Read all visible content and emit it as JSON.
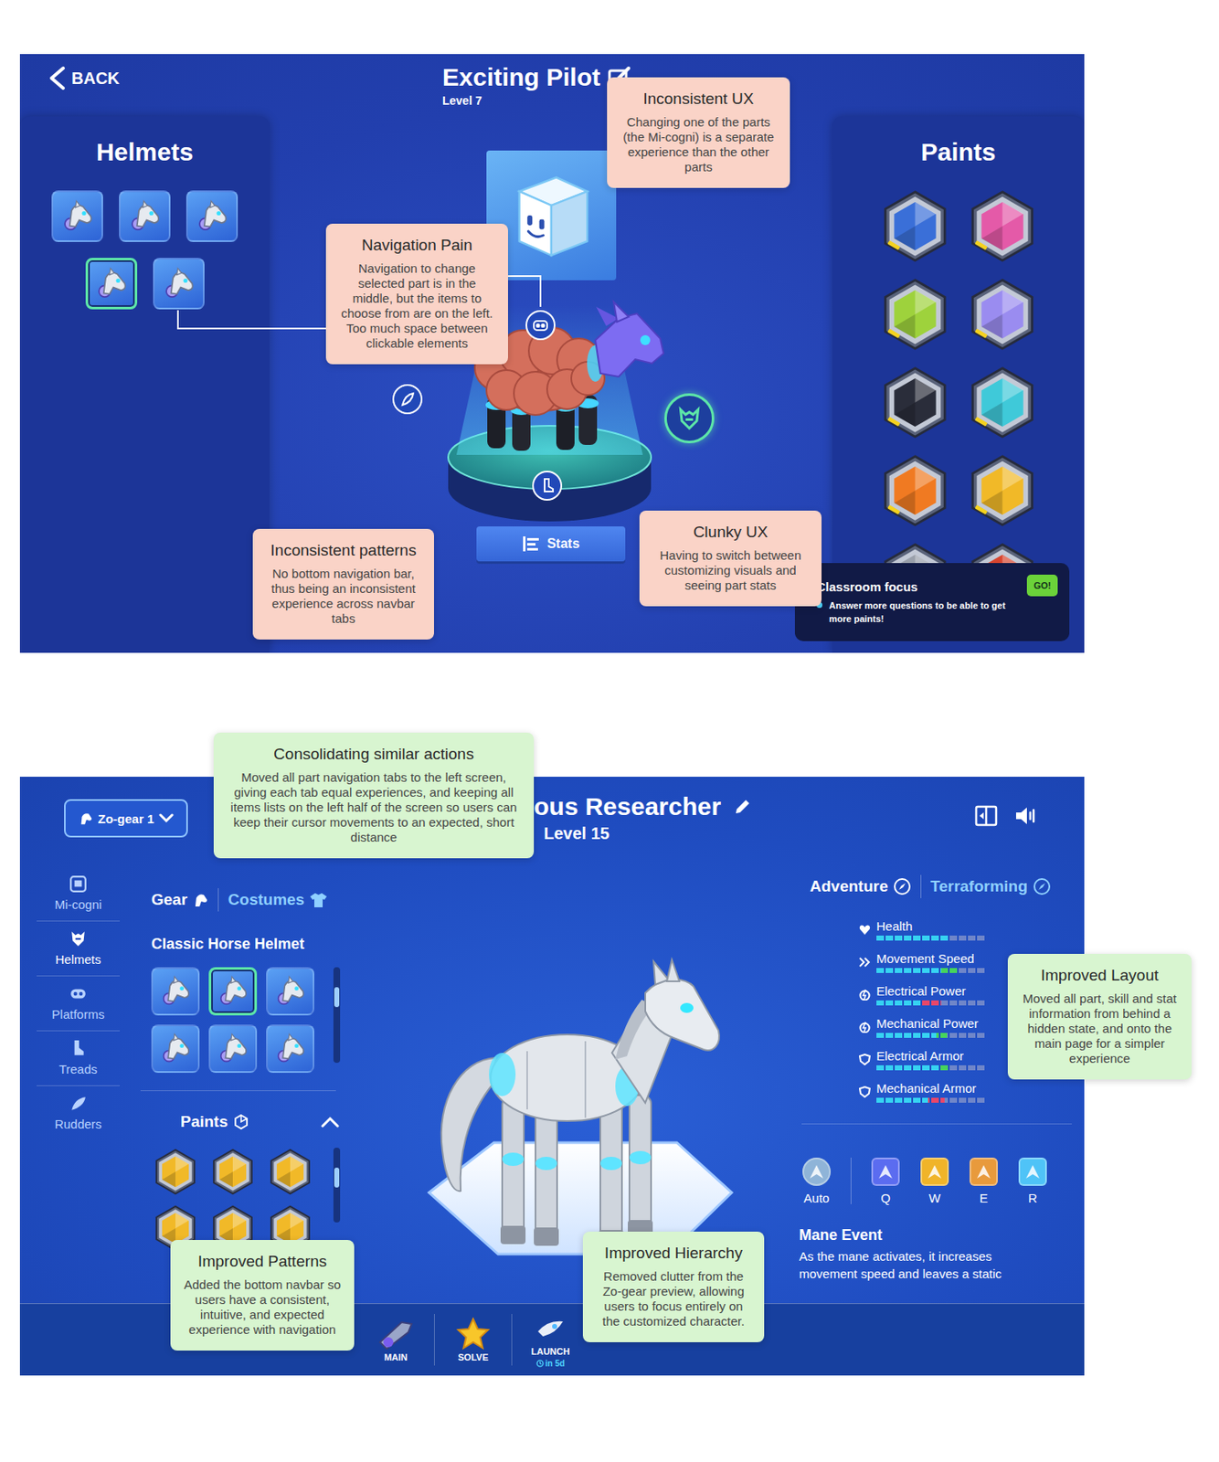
{
  "before": {
    "back": "BACK",
    "title": "Exciting Pilot",
    "level": "Level 7",
    "helmets": {
      "title": "Helmets",
      "items": [
        {
          "selected": false
        },
        {
          "selected": false
        },
        {
          "selected": false
        },
        {
          "selected": true
        },
        {
          "selected": false
        }
      ]
    },
    "paints": {
      "title": "Paints",
      "items": [
        {
          "color": "#3a6fd8"
        },
        {
          "color": "#e45aa8"
        },
        {
          "color": "#9ed23c"
        },
        {
          "color": "#9a8cf0"
        },
        {
          "color": "#2a2d3a"
        },
        {
          "color": "#3fc9d9"
        },
        {
          "color": "#f07a22"
        },
        {
          "color": "#f1b928"
        },
        {
          "color": "#9aa0ab"
        },
        {
          "color": "#d8452f"
        }
      ]
    },
    "hotspots": [
      {
        "kind": "mi-cogni",
        "selected": false
      },
      {
        "kind": "rudder",
        "selected": false
      },
      {
        "kind": "helmet",
        "selected": true
      },
      {
        "kind": "treads",
        "selected": false
      }
    ],
    "stats_button": "Stats",
    "classroom_focus": {
      "title": "Classroom focus",
      "text": "Answer more questions to be able to get more paints!",
      "button": "GO!"
    }
  },
  "after": {
    "gear_select": "Zo-gear 1",
    "title": "ous Researcher",
    "level": "Level 15",
    "parts": [
      {
        "label": "Mi-cogni",
        "kind": "mi-cogni",
        "selected": false
      },
      {
        "label": "Helmets",
        "kind": "helmet",
        "selected": true
      },
      {
        "label": "Platforms",
        "kind": "platform",
        "selected": false
      },
      {
        "label": "Treads",
        "kind": "treads",
        "selected": false
      },
      {
        "label": "Rudders",
        "kind": "rudder",
        "selected": false
      }
    ],
    "item_tabs": [
      {
        "label": "Gear",
        "selected": true
      },
      {
        "label": "Costumes",
        "selected": false
      }
    ],
    "item_name": "Classic Horse Helmet",
    "helmets": [
      {
        "selected": false
      },
      {
        "selected": true
      },
      {
        "selected": false
      },
      {
        "selected": false
      },
      {
        "selected": false
      },
      {
        "selected": false
      }
    ],
    "paints": {
      "title": "Paints",
      "expanded": true,
      "items": [
        {
          "color": "#f1b928"
        },
        {
          "color": "#f1b928"
        },
        {
          "color": "#f1b928"
        },
        {
          "color": "#f1b928"
        },
        {
          "color": "#f1b928"
        },
        {
          "color": "#f1b928"
        }
      ]
    },
    "stat_tabs": [
      {
        "label": "Adventure",
        "selected": true
      },
      {
        "label": "Terraforming",
        "selected": false
      }
    ],
    "stats": [
      {
        "name": "Health",
        "kind": "heart",
        "level": 0.68,
        "gain": 0,
        "loss": 0
      },
      {
        "name": "Movement Speed",
        "kind": "speed",
        "level": 0.6,
        "gain": 0.15,
        "loss": 0
      },
      {
        "name": "Electrical Power",
        "kind": "power",
        "level": 0.42,
        "gain": 0,
        "loss": 0.18
      },
      {
        "name": "Mechanical Power",
        "kind": "power",
        "level": 0.55,
        "gain": 0.1,
        "loss": 0
      },
      {
        "name": "Electrical Armor",
        "kind": "armor",
        "level": 0.58,
        "gain": 0.1,
        "loss": 0
      },
      {
        "name": "Mechanical Armor",
        "kind": "armor",
        "level": 0.48,
        "gain": 0,
        "loss": 0.15
      }
    ],
    "abilities": [
      {
        "key": "Auto",
        "color": "#8fb4d8"
      },
      {
        "key": "Q",
        "color": "#5b6cf0"
      },
      {
        "key": "W",
        "color": "#f0b429"
      },
      {
        "key": "E",
        "color": "#e89a3c"
      },
      {
        "key": "R",
        "color": "#4fc3f7"
      }
    ],
    "ability": {
      "name": "Mane Event",
      "description": "As the mane activates, it increases movement speed and leaves a static"
    },
    "bottom_nav": [
      {
        "label": "MAIN",
        "kind": "ship"
      },
      {
        "label": "SOLVE",
        "kind": "star"
      },
      {
        "label": "LAUNCH",
        "kind": "rocket",
        "sub": "in 5d"
      }
    ]
  },
  "callouts": [
    {
      "kind": "issue",
      "title": "Inconsistent UX",
      "text": "Changing one of the parts (the Mi-cogni) is a separate experience than the other parts"
    },
    {
      "kind": "issue",
      "title": "Navigation Pain",
      "text": "Navigation to change selected part is in the middle, but the items to choose from are on the left. Too much space between clickable elements"
    },
    {
      "kind": "issue",
      "title": "Inconsistent patterns",
      "text": "No bottom navigation bar, thus being an inconsistent experience across navbar tabs"
    },
    {
      "kind": "issue",
      "title": "Clunky UX",
      "text": "Having to switch between customizing visuals and seeing part stats"
    },
    {
      "kind": "fix",
      "title": "Consolidating similar actions",
      "text": "Moved all part navigation tabs to the left screen, giving each tab equal experiences, and keeping all items lists on the left half of the screen so users can keep their cursor movements to an expected, short distance"
    },
    {
      "kind": "fix",
      "title": "Improved Layout",
      "text": "Moved all part, skill and stat information from behind a hidden state, and onto the main page for a simpler experience"
    },
    {
      "kind": "fix",
      "title": "Improved Patterns",
      "text": "Added the bottom navbar so users have a consistent, intuitive, and expected experience with navigation"
    },
    {
      "kind": "fix",
      "title": "Improved Hierarchy",
      "text": "Removed clutter from the Zo-gear preview, allowing users to focus entirely on the customized character."
    }
  ]
}
